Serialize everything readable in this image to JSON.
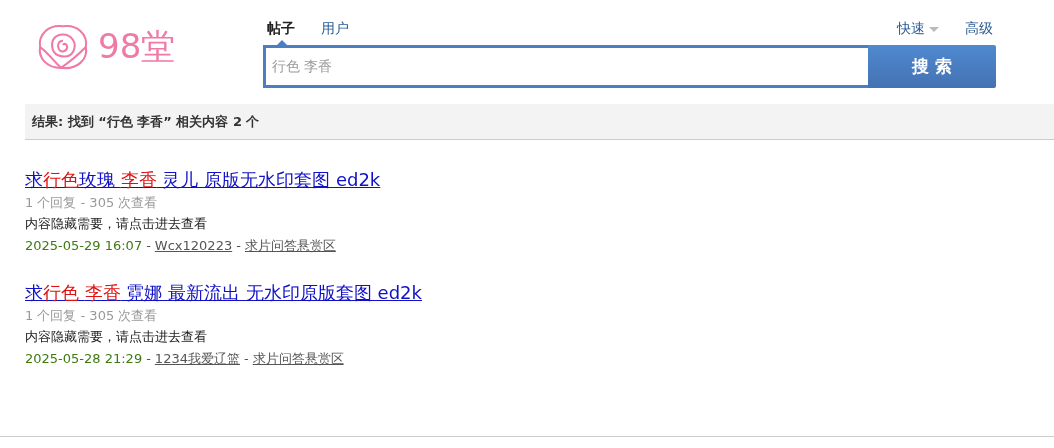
{
  "logo": {
    "text": "98堂"
  },
  "search_tabs": [
    {
      "label": "帖子",
      "selected": true
    },
    {
      "label": "用户",
      "selected": false
    }
  ],
  "quick_menu": {
    "label": "快速"
  },
  "advanced_link": "高级",
  "search": {
    "value": "行色 李香",
    "button": "搜 索"
  },
  "summary": {
    "prefix": "结果: 找到",
    "query": "“行色 李香”",
    "suffix": "相关内容 2 个"
  },
  "results": [
    {
      "title": [
        {
          "text": "求",
          "highlight": false
        },
        {
          "text": "行色",
          "highlight": true
        },
        {
          "text": "玫瑰 ",
          "highlight": false
        },
        {
          "text": "李香",
          "highlight": true
        },
        {
          "text": " 灵儿 原版无水印套图 ed2k",
          "highlight": false
        }
      ],
      "stats": "1 个回复 - 305 次查看",
      "excerpt": "内容隐藏需要，请点击进去查看",
      "meta": [
        {
          "kind": "date",
          "text": "2025-05-29 16:07"
        },
        {
          "kind": "separator",
          "text": "-"
        },
        {
          "kind": "author",
          "text": "Wcx120223"
        },
        {
          "kind": "separator",
          "text": "-"
        },
        {
          "kind": "forum",
          "text": "求片问答悬赏区"
        }
      ]
    },
    {
      "title": [
        {
          "text": "求",
          "highlight": false
        },
        {
          "text": "行色 ",
          "highlight": true
        },
        {
          "text": "李香",
          "highlight": true
        },
        {
          "text": " 霓娜 最新流出 无水印原版套图 ed2k",
          "highlight": false
        }
      ],
      "stats": "1 个回复 - 305 次查看",
      "excerpt": "内容隐藏需要，请点击进去查看",
      "meta": [
        {
          "kind": "date",
          "text": "2025-05-28 21:29"
        },
        {
          "kind": "separator",
          "text": "-"
        },
        {
          "kind": "author",
          "text": "1234我爱辽篮"
        },
        {
          "kind": "separator",
          "text": "-"
        },
        {
          "kind": "forum",
          "text": "求片问答悬赏区"
        }
      ]
    }
  ]
}
